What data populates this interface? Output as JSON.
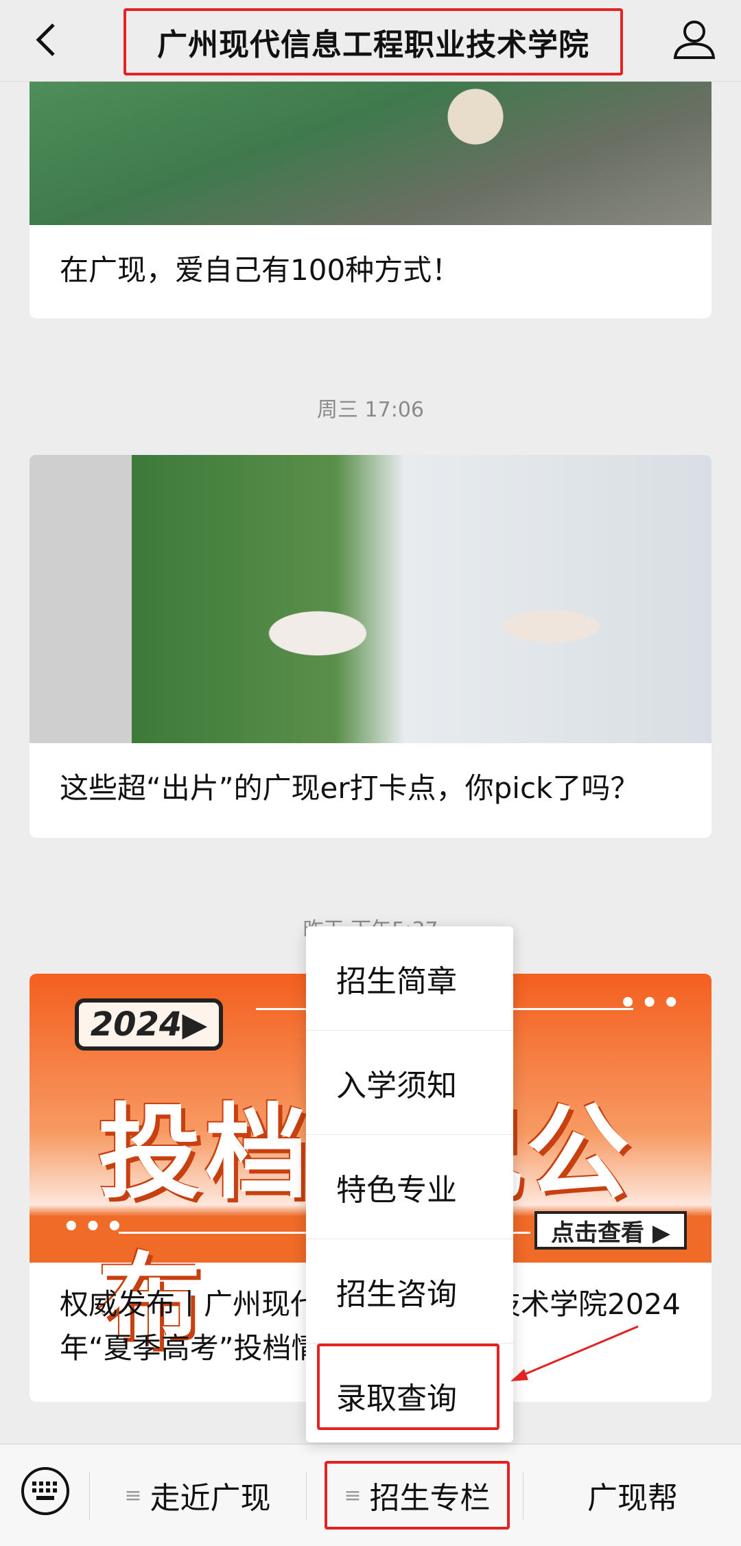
{
  "header": {
    "title": "广州现代信息工程职业技术学院",
    "back_icon": "chevron-left-icon",
    "profile_icon": "user-icon"
  },
  "feed": {
    "card1": {
      "title": "在广现，爱自己有100种方式！"
    },
    "ts2": "周三 17:06",
    "card2": {
      "title": "这些超“出片”的广现er打卡点，你pick了吗？"
    },
    "ts3": "昨天 下午5:37",
    "card3": {
      "banner_year": "2024▶",
      "banner_big": "投档情况公布",
      "banner_btn": "点击查看 ▶",
      "banner_dots": "•••",
      "title": "权威发布丨广州现代信息工程职业技术学院2024年“夏季高考”投档情况"
    }
  },
  "menu": {
    "items": [
      "招生简章",
      "入学须知",
      "特色专业",
      "招生咨询",
      "录取查询"
    ]
  },
  "bottombar": {
    "keyboard_icon": "keyboard-icon",
    "tabs": [
      {
        "glyph": "≡",
        "label": "走近广现"
      },
      {
        "glyph": "≡",
        "label": "招生专栏"
      },
      {
        "label": "广现帮"
      }
    ]
  },
  "colors": {
    "highlight": "#e32222",
    "banner_orange": "#f45f1e"
  }
}
